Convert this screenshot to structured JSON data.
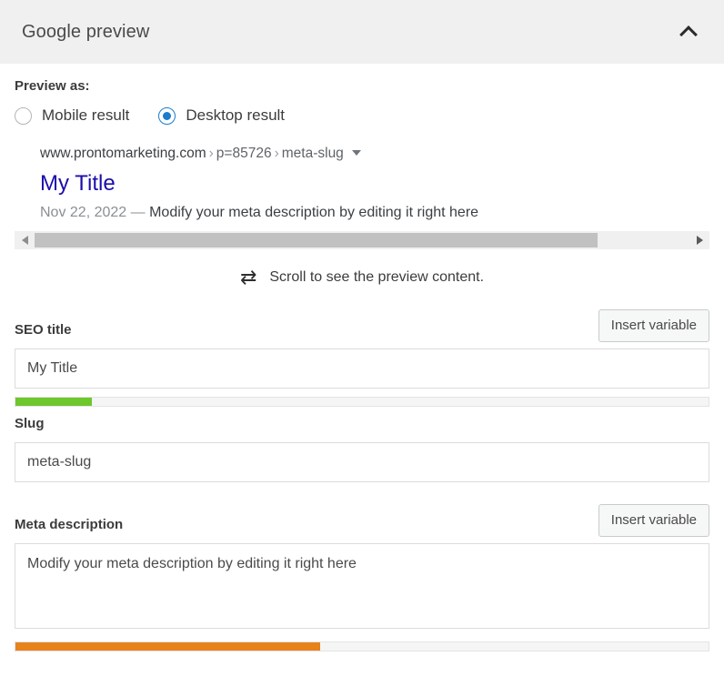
{
  "header": {
    "title": "Google preview",
    "collapse_icon": "chevron-up-icon"
  },
  "preview_as": {
    "label": "Preview as:",
    "options": [
      {
        "label": "Mobile result",
        "selected": false
      },
      {
        "label": "Desktop result",
        "selected": true
      }
    ]
  },
  "serp_preview": {
    "url": {
      "domain": "www.prontomarketing.com",
      "separator": "›",
      "segments": [
        "p=85726",
        "meta-slug"
      ],
      "caret_icon": "chevron-down-icon"
    },
    "title": "My Title",
    "date": "Nov 22, 2022",
    "dash": "—",
    "description": "Modify your meta description by editing it right here",
    "scrollbar": {
      "left_arrow_icon": "arrow-left-icon",
      "right_arrow_icon": "arrow-right-icon",
      "thumb_percent": 86
    }
  },
  "scroll_hint": {
    "icon": "swap-horizontal-icon",
    "glyph": "⇄",
    "text": "Scroll to see the preview content."
  },
  "seo_title": {
    "label": "SEO title",
    "insert_variable_label": "Insert variable",
    "value": "My Title",
    "progress_percent": 11,
    "progress_color": "#6ec72d"
  },
  "slug": {
    "label": "Slug",
    "value": "meta-slug"
  },
  "meta_description": {
    "label": "Meta description",
    "insert_variable_label": "Insert variable",
    "value": "Modify your meta description by editing it right here",
    "progress_percent": 44,
    "progress_color": "#e8821a"
  }
}
